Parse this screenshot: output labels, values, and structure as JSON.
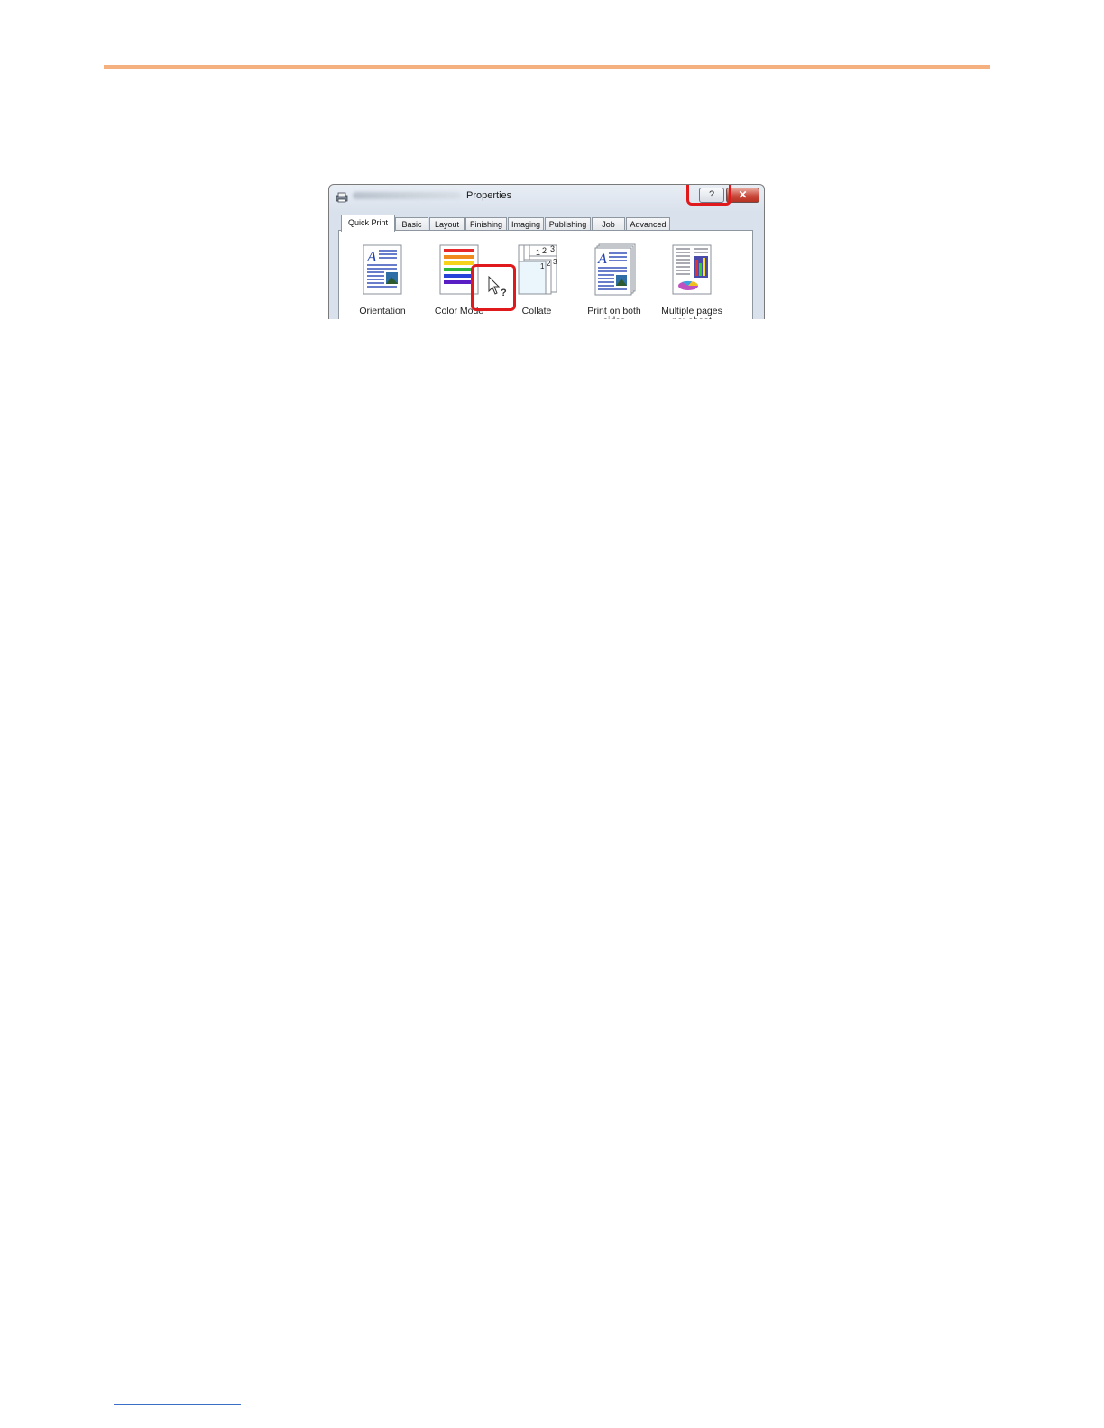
{
  "dialog": {
    "title": "Properties",
    "help_button_glyph": "?",
    "close_button_glyph": "✕",
    "tabs": [
      {
        "label": "Quick Print",
        "active": true
      },
      {
        "label": "Basic"
      },
      {
        "label": "Layout"
      },
      {
        "label": "Finishing"
      },
      {
        "label": "Imaging"
      },
      {
        "label": "Publishing"
      },
      {
        "label": "Job"
      },
      {
        "label": "Advanced"
      }
    ],
    "items": [
      {
        "label": "Orientation",
        "icon": "orientation-icon"
      },
      {
        "label": "Color Mode",
        "icon": "color-mode-icon"
      },
      {
        "label": "Collate",
        "icon": "collate-icon"
      },
      {
        "label": "Print on both\nsides",
        "icon": "duplex-icon"
      },
      {
        "label": "Multiple pages\nper sheet",
        "icon": "multiple-pages-icon"
      }
    ],
    "collate_numbers": [
      "1",
      "2",
      "3"
    ]
  },
  "colors": {
    "header_rule": "#f5b07f",
    "highlight": "#e0191d",
    "footer_rule": "#3b6fc9"
  }
}
